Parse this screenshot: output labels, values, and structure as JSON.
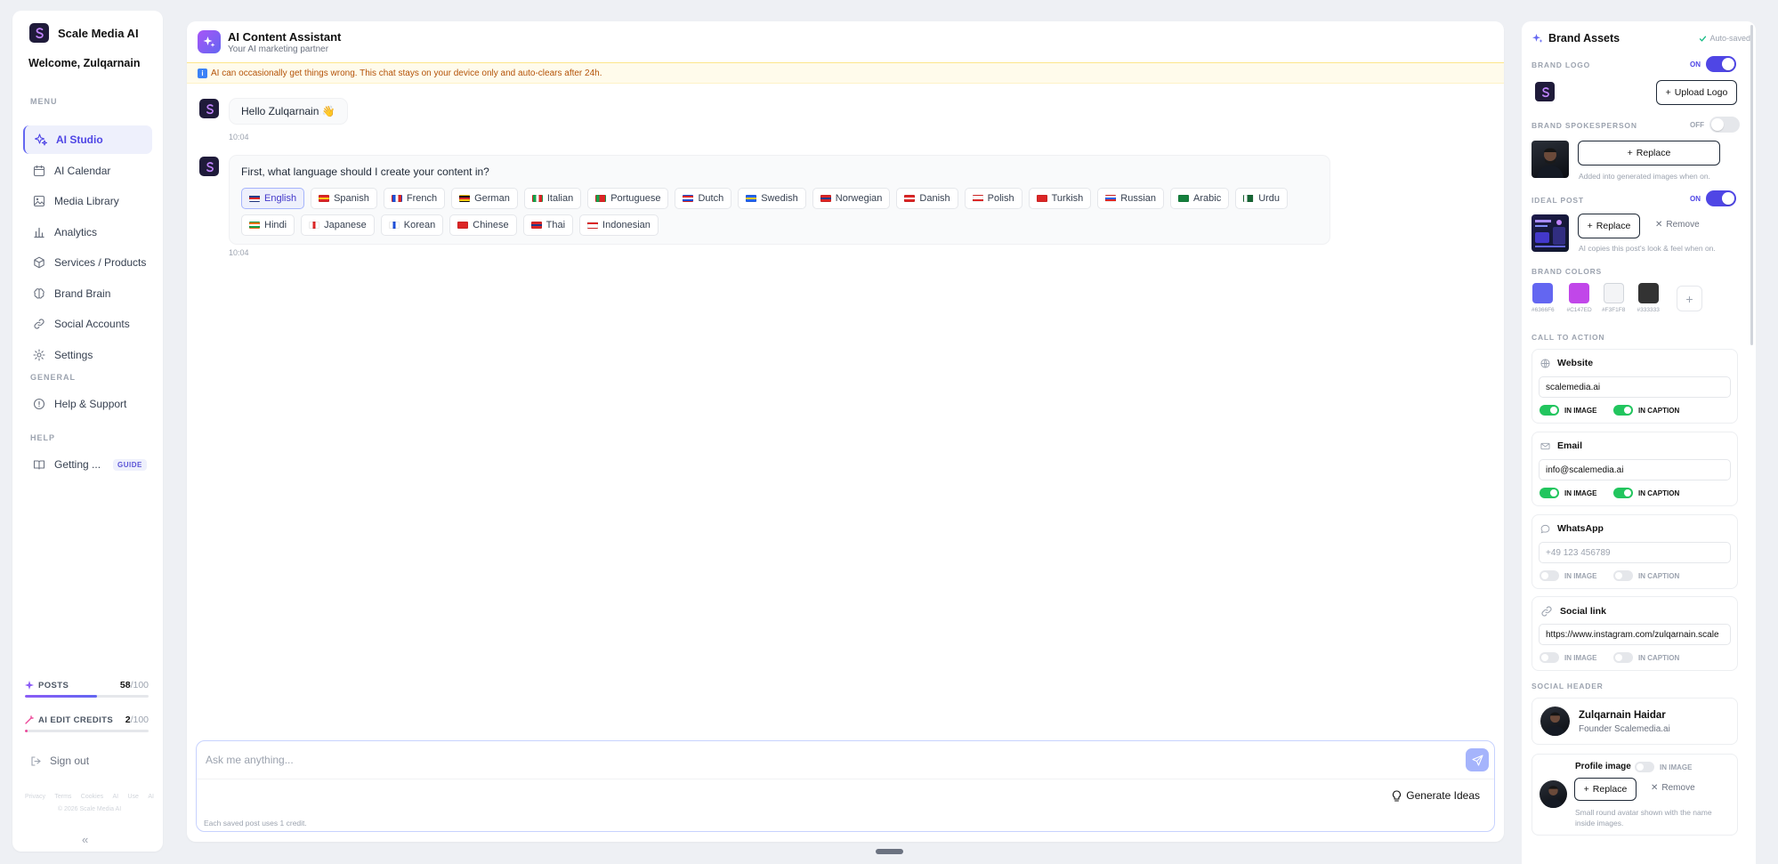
{
  "sidebar": {
    "app_name": "Scale Media AI",
    "welcome": "Welcome, Zulqarnain",
    "menu_label": "MENU",
    "menu_items": [
      {
        "label": "AI Studio",
        "icon": "sparkles-icon",
        "active": true
      },
      {
        "label": "AI Calendar",
        "icon": "calendar-icon"
      },
      {
        "label": "Media Library",
        "icon": "image-icon"
      },
      {
        "label": "Analytics",
        "icon": "bar-chart-icon"
      },
      {
        "label": "Services / Products",
        "icon": "box-icon"
      },
      {
        "label": "Brand Brain",
        "icon": "brain-icon"
      },
      {
        "label": "Social Accounts",
        "icon": "link-icon"
      },
      {
        "label": "Settings",
        "icon": "gear-icon"
      }
    ],
    "general_label": "GENERAL",
    "general_items": [
      {
        "label": "Help & Support",
        "icon": "help-circle-icon"
      }
    ],
    "help_label": "HELP",
    "help_items": [
      {
        "label": "Getting ...",
        "icon": "book-icon",
        "badge": "GUIDE"
      }
    ],
    "usage": {
      "posts_label": "POSTS",
      "posts_used": "58",
      "posts_total": "/100",
      "posts_fraction": 0.58,
      "credits_label": "AI EDIT CREDITS",
      "credits_used": "2",
      "credits_total": "/100",
      "credits_fraction": 0.02
    },
    "sign_out": "Sign out",
    "footer_links": [
      "Privacy",
      "Terms",
      "Cookies",
      "AI",
      "Use",
      "AI"
    ],
    "copyright": "© 2026 Scale Media AI"
  },
  "chat": {
    "title": "AI Content Assistant",
    "subtitle": "Your AI marketing partner",
    "notice": "AI can occasionally get things wrong. This chat stays on your device only and auto-clears after 24h.",
    "messages": [
      {
        "text": "Hello Zulqarnain 👋",
        "time": "10:04"
      },
      {
        "text": "First, what language should I create your content in?",
        "time": "10:04"
      }
    ],
    "languages": [
      {
        "label": "English",
        "selected": true,
        "flag": [
          "#1e3a8a",
          "#dc2626",
          "#ffffff"
        ]
      },
      {
        "label": "Spanish",
        "flag": [
          "#dc2626",
          "#facc15",
          "#dc2626"
        ]
      },
      {
        "label": "French",
        "flag": [
          "#1d4ed8",
          "#ffffff",
          "#dc2626"
        ],
        "vertical": true
      },
      {
        "label": "German",
        "flag": [
          "#111111",
          "#dc2626",
          "#facc15"
        ]
      },
      {
        "label": "Italian",
        "flag": [
          "#16a34a",
          "#ffffff",
          "#dc2626"
        ],
        "vertical": true
      },
      {
        "label": "Portuguese",
        "flag": [
          "#16a34a",
          "#dc2626",
          "#dc2626"
        ],
        "vertical": true
      },
      {
        "label": "Dutch",
        "flag": [
          "#dc2626",
          "#ffffff",
          "#1d4ed8"
        ]
      },
      {
        "label": "Swedish",
        "flag": [
          "#2563eb",
          "#facc15",
          "#2563eb"
        ]
      },
      {
        "label": "Norwegian",
        "flag": [
          "#dc2626",
          "#1e3a8a",
          "#dc2626"
        ]
      },
      {
        "label": "Danish",
        "flag": [
          "#dc2626",
          "#ffffff",
          "#dc2626"
        ]
      },
      {
        "label": "Polish",
        "flag": [
          "#ffffff",
          "#ffffff",
          "#dc2626"
        ]
      },
      {
        "label": "Turkish",
        "flag": [
          "#dc2626",
          "#dc2626",
          "#dc2626"
        ]
      },
      {
        "label": "Russian",
        "flag": [
          "#ffffff",
          "#2563eb",
          "#dc2626"
        ]
      },
      {
        "label": "Arabic",
        "flag": [
          "#15803d",
          "#15803d",
          "#15803d"
        ]
      },
      {
        "label": "Urdu",
        "flag": [
          "#ffffff",
          "#166534",
          "#166534"
        ],
        "vertical": true
      },
      {
        "label": "Hindi",
        "flag": [
          "#f97316",
          "#ffffff",
          "#16a34a"
        ]
      },
      {
        "label": "Japanese",
        "flag": [
          "#ffffff",
          "#dc2626",
          "#ffffff"
        ],
        "vertical": true
      },
      {
        "label": "Korean",
        "flag": [
          "#ffffff",
          "#1d4ed8",
          "#ffffff"
        ],
        "vertical": true
      },
      {
        "label": "Chinese",
        "flag": [
          "#dc2626",
          "#dc2626",
          "#dc2626"
        ]
      },
      {
        "label": "Thai",
        "flag": [
          "#dc2626",
          "#1e3a8a",
          "#dc2626"
        ]
      },
      {
        "label": "Indonesian",
        "flag": [
          "#dc2626",
          "#ffffff",
          "#ffffff"
        ]
      }
    ],
    "composer_placeholder": "Ask me anything...",
    "generate_ideas": "Generate Ideas",
    "composer_note": "Each saved post uses 1 credit."
  },
  "brand": {
    "title": "Brand Assets",
    "autosaved": "Auto-saved",
    "logo_label": "BRAND LOGO",
    "logo_toggle": "ON",
    "logo_on": true,
    "upload_logo": "Upload Logo",
    "spokesperson_label": "BRAND SPOKESPERSON",
    "spokesperson_toggle": "OFF",
    "spokesperson_on": false,
    "replace": "Replace",
    "spokesperson_hint": "Added into generated images when on.",
    "ideal_post_label": "IDEAL POST",
    "ideal_post_toggle": "ON",
    "ideal_post_on": true,
    "remove": "Remove",
    "ideal_post_hint": "AI copies this post's look & feel when on.",
    "colors_label": "BRAND COLORS",
    "colors": [
      {
        "hex": "#6366F1",
        "label": "#6366F6"
      },
      {
        "hex": "#C147E9",
        "label": "#C147ED"
      },
      {
        "hex": "#F3F4F6",
        "label": "#F3F1F8"
      },
      {
        "hex": "#333333",
        "label": "#333333"
      }
    ],
    "cta_label": "CALL TO ACTION",
    "cta": [
      {
        "title": "Website",
        "icon": "globe-icon",
        "value": "scalemedia.ai",
        "placeholder": "",
        "in_image": true,
        "in_caption": true
      },
      {
        "title": "Email",
        "icon": "mail-icon",
        "value": "info@scalemedia.ai",
        "placeholder": "",
        "in_image": true,
        "in_caption": true
      },
      {
        "title": "WhatsApp",
        "icon": "chat-bubble-icon",
        "value": "",
        "placeholder": "+49 123 456789",
        "in_image": false,
        "in_caption": false
      },
      {
        "title": "Social link",
        "icon": "link-icon",
        "value": "https://www.instagram.com/zulqarnain.scale",
        "placeholder": "",
        "in_image": false,
        "in_caption": false
      }
    ],
    "in_image": "IN IMAGE",
    "in_caption": "IN CAPTION",
    "social_header_label": "SOCIAL HEADER",
    "social_name": "Zulqarnain Haidar",
    "social_role": "Founder Scalemedia.ai",
    "profile_image_label": "Profile image",
    "profile_in_image": "IN IMAGE",
    "profile_hint": "Small round avatar shown with the name inside images."
  }
}
